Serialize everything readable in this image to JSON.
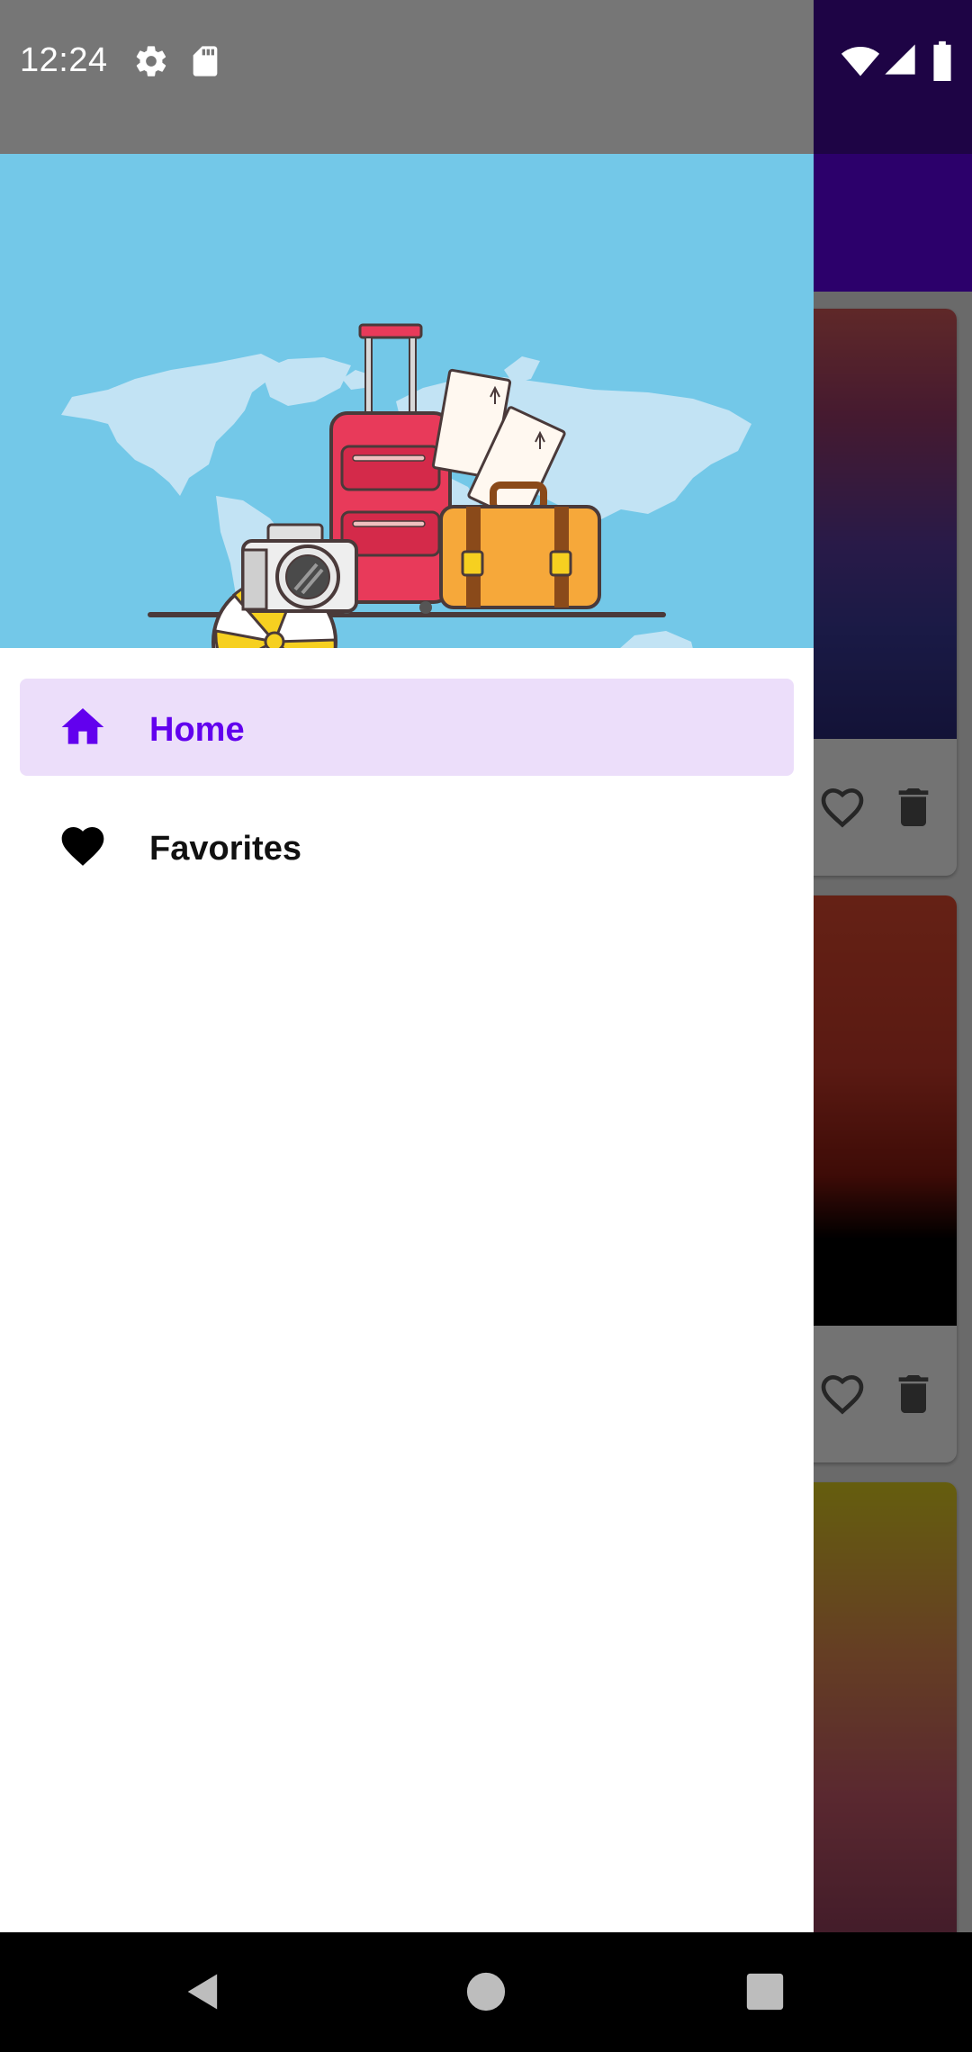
{
  "status_bar": {
    "time": "12:24",
    "icons_left": [
      "settings-icon",
      "sd-card-icon"
    ],
    "icons_right": [
      "wifi-icon",
      "signal-icon",
      "battery-icon"
    ]
  },
  "drawer": {
    "header_image": "travel-luggage-world-map-illustration",
    "items": [
      {
        "label": "Home",
        "icon": "home-icon",
        "selected": true
      },
      {
        "label": "Favorites",
        "icon": "heart-icon",
        "selected": false
      }
    ]
  },
  "background_cards": [
    {
      "image": "purple-sunset-mountains",
      "actions": [
        "heart-outline-icon",
        "delete-icon"
      ]
    },
    {
      "image": "red-sunset-tower-silhouette",
      "actions": [
        "heart-outline-icon",
        "delete-icon"
      ]
    },
    {
      "image": "yellow-pink-gradient-sky",
      "actions": []
    }
  ],
  "nav_bar": {
    "buttons": [
      "back-icon",
      "home-circle-icon",
      "recents-icon"
    ]
  },
  "colors": {
    "primary": "#6200ee",
    "primary_dark": "#1e0445",
    "selected_item_bg": "#ecdefa",
    "header_sky": "#73c8e8"
  }
}
